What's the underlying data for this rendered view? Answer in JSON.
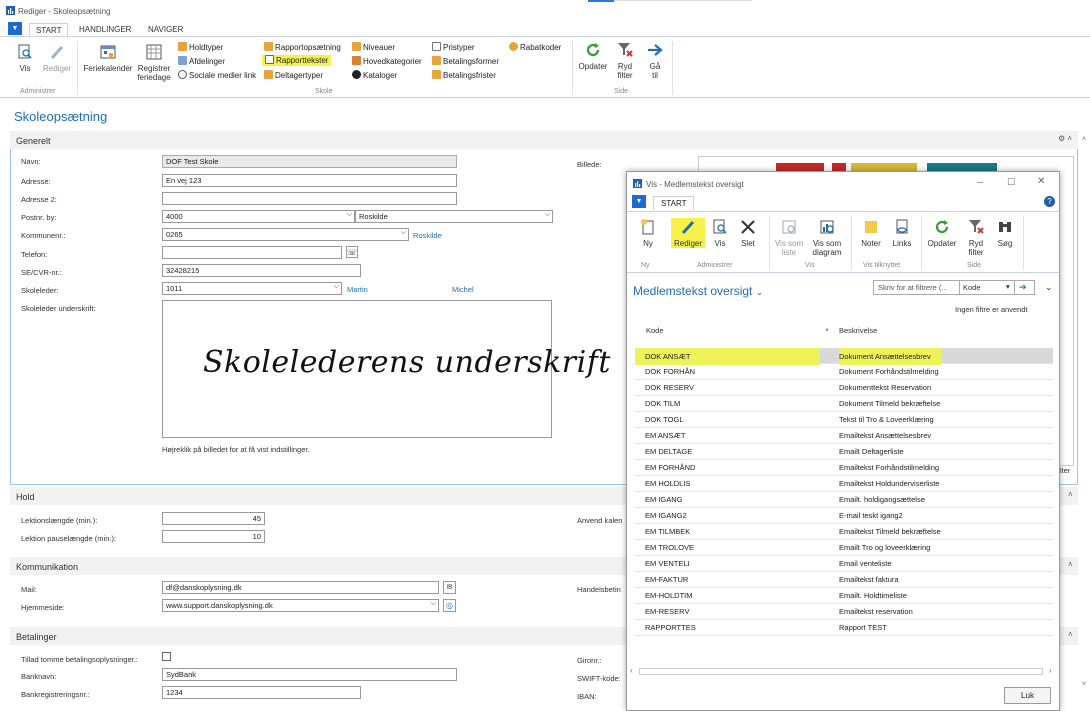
{
  "window": {
    "title": "Rediger - Skoleopsætning"
  },
  "tabs": [
    "START",
    "HANDLINGER",
    "NAVIGER"
  ],
  "ribbon": {
    "vis": "Vis",
    "rediger": "Rediger",
    "administrer": "Administrer",
    "feriekalender": "Feriekalender",
    "registrer_1": "Registrer",
    "registrer_2": "feriedage",
    "holdtyper": "Holdtyper",
    "afdelinger": "Afdelinger",
    "sociale": "Sociale medier link",
    "rapportopsaetning": "Rapportopsætning",
    "rapporttekster": "Rapporttekster",
    "deltagertyper": "Deltagertyper",
    "niveauer": "Niveauer",
    "hovedkategorier": "Hovedkategorier",
    "kataloger": "Kataloger",
    "pristyper": "Pristyper",
    "betalingsformer": "Betalingsformer",
    "betalingsfrister": "Betalingsfrister",
    "rabatkoder": "Rabatkoder",
    "skole": "Skole",
    "opdater": "Opdater",
    "ryd_1": "Ryd",
    "ryd_2": "filter",
    "gaa_1": "Gå",
    "gaa_2": "til",
    "side": "Side"
  },
  "page_title": "Skoleopsætning",
  "generelt": {
    "header": "Generelt",
    "navn_label": "Navn:",
    "navn": "DOF Test Skole",
    "adresse_label": "Adresse:",
    "adresse": "En vej 123",
    "adresse2_label": "Adresse 2:",
    "adresse2": "",
    "postnr_label": "Postnr. by:",
    "postnr": "4000",
    "by": "Roskilde",
    "kommunenr_label": "Kommunenr.:",
    "kommunenr": "0265",
    "kommune_link": "Roskilde",
    "telefon_label": "Telefon:",
    "telefon": "",
    "cvr_label": "SE/CVR-nr.:",
    "cvr": "32428215",
    "skoleleder_label": "Skoleleder:",
    "skoleleder": "1011",
    "skoleleder_fornavn": "Martin",
    "skoleleder_efternavn": "Michel",
    "underskrift_label": "Skoleleder underskrift:",
    "underskrift_text": "Skolelederens underskrift",
    "hint": "Højreklik på billedet for at få vist indstillinger.",
    "billede_label": "Billede:",
    "filter_cut": "lter"
  },
  "hold": {
    "header": "Hold",
    "lektion_label": "Lektionslængde (min.):",
    "lektion": "45",
    "pause_label": "Lektion pauselængde (min.):",
    "pause": "10",
    "anvend_cut": "Anvend kalen"
  },
  "kommunikation": {
    "header": "Kommunikation",
    "mail_label": "Mail:",
    "mail": "df@danskoplysning.dk",
    "hjemmeside_label": "Hjemmeside:",
    "hjemmeside": "www.support.danskoplysning.dk",
    "handels_cut": "Handelsbetin"
  },
  "betalinger": {
    "header": "Betalinger",
    "tillad_label": "Tillad tomme betalingsoplysninger.:",
    "banknavn_label": "Banknavn:",
    "banknavn": "SydBank",
    "bankreg_label": "Bankregistreringsnr.:",
    "bankreg": "1234",
    "gironr_label": "Gironr.:",
    "swift_label": "SWIFT-kode:",
    "iban_label": "IBAN:"
  },
  "modal": {
    "title": "Vis - Medlemstekst oversigt",
    "tab": "START",
    "ny": "Ny",
    "rediger": "Rediger",
    "vis": "Vis",
    "slet": "Slet",
    "vis_som_liste_1": "Vis som",
    "vis_som_liste_2": "liste",
    "vis_som_diagram_1": "Vis som",
    "vis_som_diagram_2": "diagram",
    "noter": "Noter",
    "links": "Links",
    "opdater": "Opdater",
    "ryd_1": "Ryd",
    "ryd_2": "filter",
    "soeg": "Søg",
    "grp_ny": "Ny",
    "grp_admin": "Administrer",
    "grp_vis": "Vis",
    "grp_tilknyttet": "Vis tilknyttet",
    "grp_side": "Side",
    "list_title": "Medlemstekst oversigt",
    "filter_placeholder": "Skriv for at filtrere (...",
    "filter_field": "Kode",
    "no_filters": "Ingen filtre er anvendt",
    "col_kode": "Kode",
    "col_beskrivelse": "Beskrivelse",
    "rows": [
      {
        "kode": "DOK ANSÆT",
        "beskrivelse": "Dokument Ansættelsesbrev"
      },
      {
        "kode": "DOK FORHÅN",
        "beskrivelse": "Dokument Forhåndstilmelding"
      },
      {
        "kode": "DOK RESERV",
        "beskrivelse": "Dokumenttekst Reservation"
      },
      {
        "kode": "DOK TILM",
        "beskrivelse": "Dokument Tilmeld bekræftelse"
      },
      {
        "kode": "DOK TOGL",
        "beskrivelse": "Tekst til Tro & Loveerklæring"
      },
      {
        "kode": "EM ANSÆT",
        "beskrivelse": "Emailtekst Ansættelsesbrev"
      },
      {
        "kode": "EM DELTAGE",
        "beskrivelse": "Emailt Deltagerliste"
      },
      {
        "kode": "EM FORHÅND",
        "beskrivelse": "Emailtekst Forhåndstilmelding"
      },
      {
        "kode": "EM HOLDLIS",
        "beskrivelse": "Emailtekst Holdunderviserliste"
      },
      {
        "kode": "EM IGANG",
        "beskrivelse": "Emailt. holdigangsættelse"
      },
      {
        "kode": "EM IGANG2",
        "beskrivelse": "E-mail teskt igang2"
      },
      {
        "kode": "EM TILMBEK",
        "beskrivelse": "Emailtekst Tilmeld bekræftelse"
      },
      {
        "kode": "EM TROLOVE",
        "beskrivelse": "Emailt Tro og loveerklæring"
      },
      {
        "kode": "EM VENTELI",
        "beskrivelse": "Email venteliste"
      },
      {
        "kode": "EM-FAKTUR",
        "beskrivelse": "Emailtekst faktura"
      },
      {
        "kode": "EM-HOLDTIM",
        "beskrivelse": "Emailt. Holdtimeliste"
      },
      {
        "kode": "EM-RESERV",
        "beskrivelse": "Emailtekst reservation"
      },
      {
        "kode": "RAPPORTTES",
        "beskrivelse": "Rapport TEST"
      }
    ],
    "close": "Luk"
  },
  "colors": {
    "accent": "#1f6fb5",
    "highlight": "#f7f24a",
    "selected_row": "#d9d9d9"
  }
}
